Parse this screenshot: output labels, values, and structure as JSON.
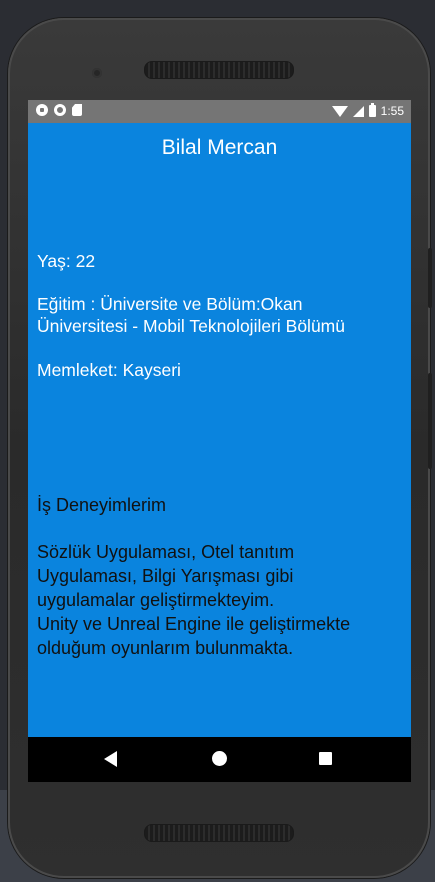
{
  "status_bar": {
    "time": "1:55",
    "left_icons": [
      "notification-icon",
      "circle-icon",
      "sd-card-icon"
    ],
    "right_icons": [
      "wifi-icon",
      "cell-signal-icon",
      "battery-icon"
    ]
  },
  "app": {
    "title": "Bilal Mercan",
    "age": "Yaş: 22",
    "education_line1": "Eğitim : Üniversite ve Bölüm:Okan",
    "education_line2": "Üniversitesi - Mobil Teknolojileri Bölümü",
    "hometown": "Memleket: Kayseri",
    "experience_heading": "İş Deneyimlerim",
    "experience_lines": [
      "Sözlük Uygulaması, Otel tanıtım",
      "Uygulaması, Bilgi Yarışması gibi",
      "uygulamalar geliştirmekteyim.",
      "Unity ve Unreal Engine ile geliştirmekte",
      "olduğum oyunlarım bulunmakta."
    ]
  },
  "nav_bar": {
    "buttons": [
      "back-icon",
      "home-icon",
      "recents-icon"
    ]
  },
  "colors": {
    "app_background": "#0a84de",
    "status_bar": "#757575",
    "nav_bar": "#000000"
  }
}
